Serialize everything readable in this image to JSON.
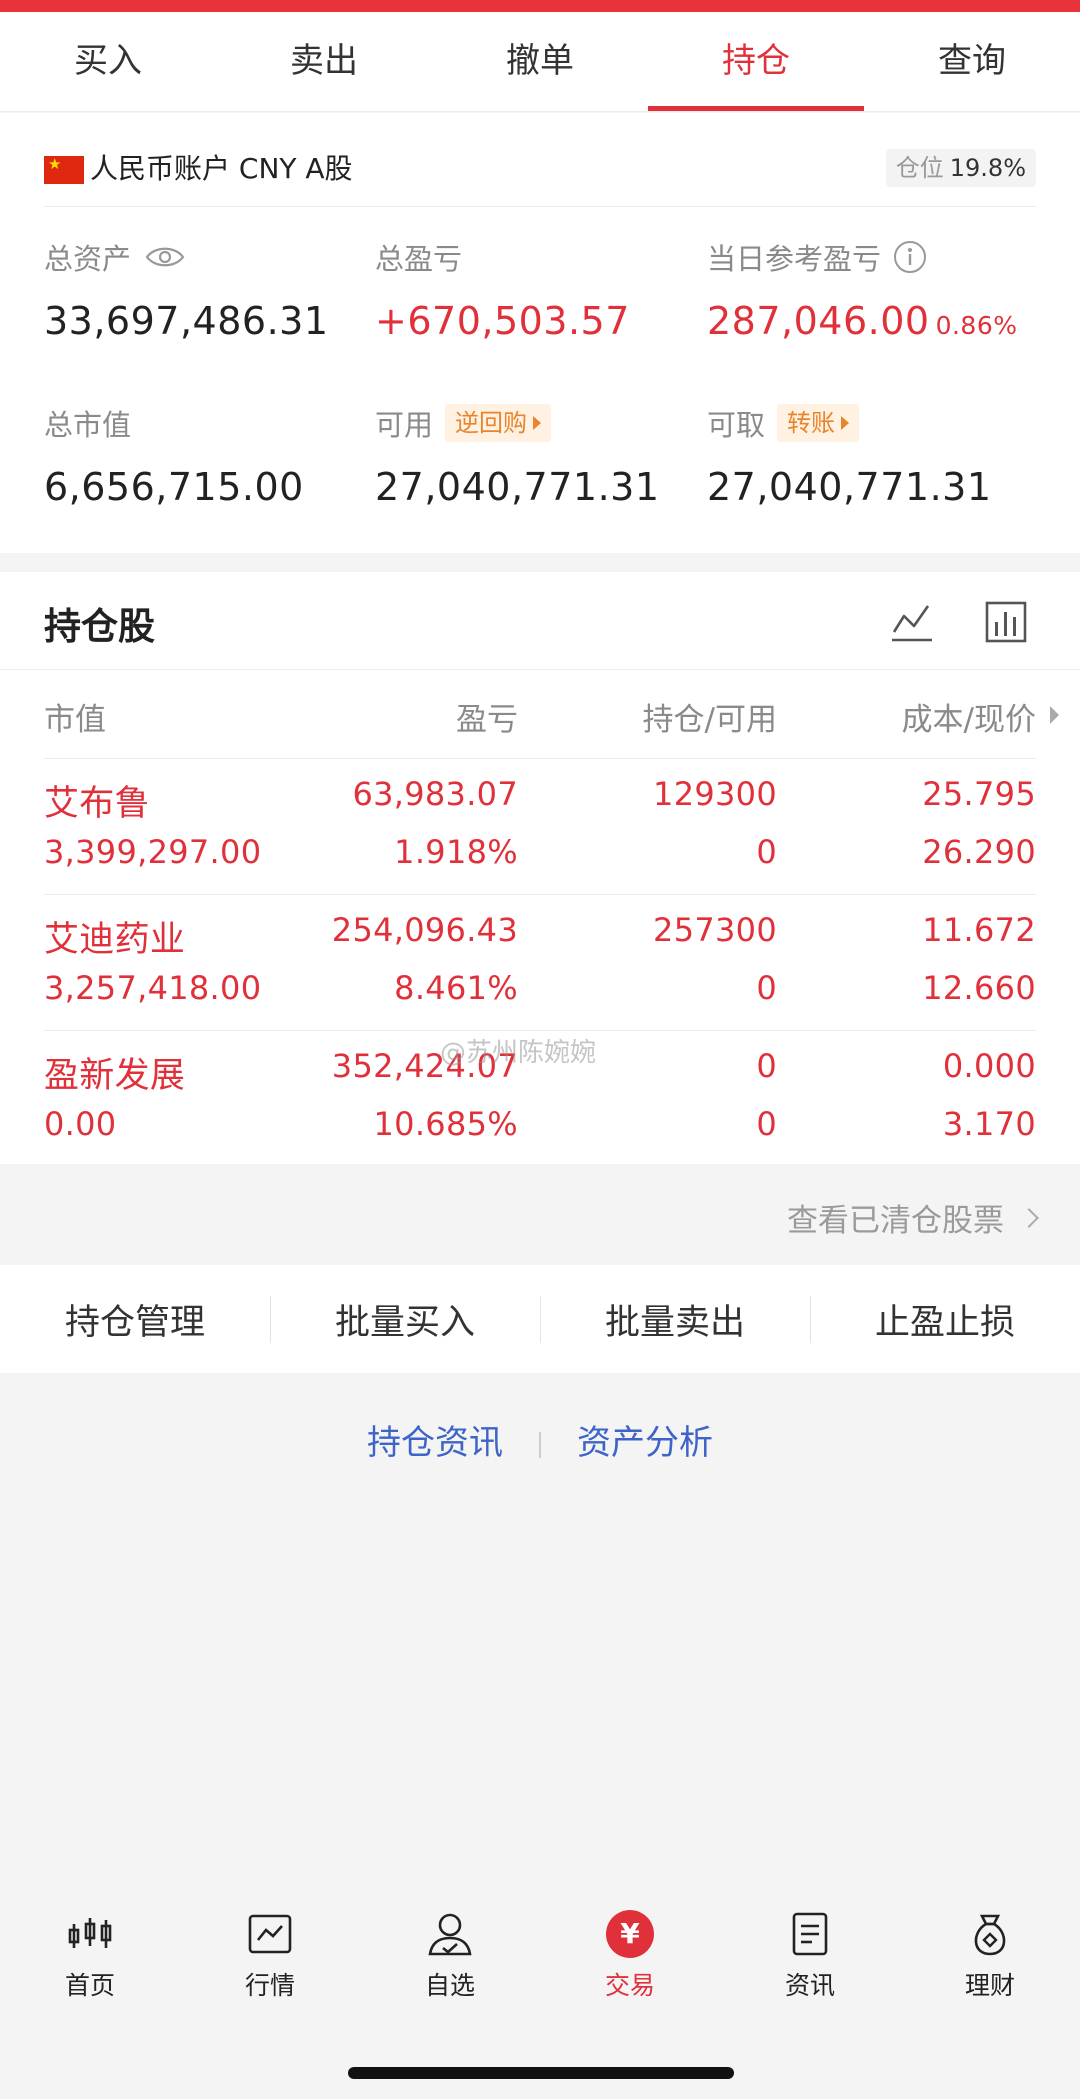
{
  "tabs": [
    {
      "label": "买入",
      "active": false
    },
    {
      "label": "卖出",
      "active": false
    },
    {
      "label": "撤单",
      "active": false
    },
    {
      "label": "持仓",
      "active": true
    },
    {
      "label": "查询",
      "active": false
    }
  ],
  "account": {
    "name": "人民币账户 CNY A股",
    "flag_icon": "china-flag-icon",
    "position_label": "仓位",
    "position_value": "19.8%"
  },
  "summary": {
    "total_assets": {
      "label": "总资产",
      "value": "33,697,486.31"
    },
    "total_pnl": {
      "label": "总盈亏",
      "value": "+670,503.57"
    },
    "daily_pnl": {
      "label": "当日参考盈亏",
      "value": "287,046.00",
      "pct": "0.86%"
    },
    "market_value": {
      "label": "总市值",
      "value": "6,656,715.00"
    },
    "available": {
      "label": "可用",
      "value": "27,040,771.31",
      "tag": "逆回购"
    },
    "withdrawable": {
      "label": "可取",
      "value": "27,040,771.31",
      "tag": "转账"
    }
  },
  "holdings": {
    "title": "持仓股",
    "columns": {
      "c1": "市值",
      "c2": "盈亏",
      "c3": "持仓/可用",
      "c4": "成本/现价"
    },
    "rows": [
      {
        "name": "艾布鲁",
        "market_value": "3,399,297.00",
        "pnl": "63,983.07",
        "pnl_pct": "1.918%",
        "holding": "129300",
        "available": "0",
        "cost": "25.795",
        "price": "26.290"
      },
      {
        "name": "艾迪药业",
        "market_value": "3,257,418.00",
        "pnl": "254,096.43",
        "pnl_pct": "8.461%",
        "holding": "257300",
        "available": "0",
        "cost": "11.672",
        "price": "12.660"
      },
      {
        "name": "盈新发展",
        "market_value": "0.00",
        "pnl": "352,424.07",
        "pnl_pct": "10.685%",
        "holding": "0",
        "available": "0",
        "cost": "0.000",
        "price": "3.170"
      }
    ],
    "cleared_link": "查看已清仓股票"
  },
  "actions": [
    "持仓管理",
    "批量买入",
    "批量卖出",
    "止盈止损"
  ],
  "links": {
    "news": "持仓资讯",
    "analysis": "资产分析"
  },
  "watermark": "@苏州陈婉婉",
  "tabbar": [
    {
      "label": "首页",
      "icon": "candlestick-icon",
      "active": false
    },
    {
      "label": "行情",
      "icon": "chart-icon",
      "active": false
    },
    {
      "label": "自选",
      "icon": "user-check-icon",
      "active": false
    },
    {
      "label": "交易",
      "icon": "yen-icon",
      "active": true
    },
    {
      "label": "资讯",
      "icon": "document-icon",
      "active": false
    },
    {
      "label": "理财",
      "icon": "money-bag-icon",
      "active": false
    }
  ],
  "colors": {
    "accent": "#e0313a",
    "link": "#3e64c8",
    "tag": "#e8852c"
  }
}
